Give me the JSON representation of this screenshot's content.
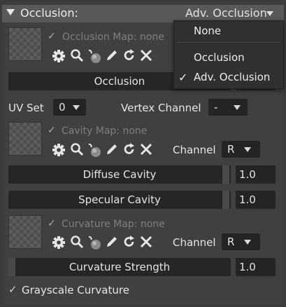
{
  "header": {
    "title": "Occlusion:",
    "mode_label": "Adv. Occlusion"
  },
  "mode_menu": {
    "items": [
      {
        "label": "None",
        "checked": false
      },
      {
        "label": "Occlusion",
        "checked": false
      },
      {
        "label": "Adv. Occlusion",
        "checked": true
      }
    ]
  },
  "occlusion_map": {
    "label": "Occlusion Map:",
    "value": "none",
    "enabled": true
  },
  "occlusion_slider": {
    "label": "Occlusion"
  },
  "uv_set": {
    "label": "UV Set",
    "value": "0"
  },
  "vertex_channel": {
    "label": "Vertex Channel",
    "value": "-"
  },
  "cavity_map": {
    "label": "Cavity Map:",
    "value": "none",
    "enabled": true,
    "channel_label": "Channel",
    "channel_value": "R"
  },
  "diffuse_cavity": {
    "label": "Diffuse Cavity",
    "value": "1.0",
    "level": 1.0
  },
  "specular_cavity": {
    "label": "Specular Cavity",
    "value": "1.0",
    "level": 1.0
  },
  "curvature_map": {
    "label": "Curvature Map:",
    "value": "none",
    "enabled": true,
    "channel_label": "Channel",
    "channel_value": "R"
  },
  "curvature_strength": {
    "label": "Curvature Strength",
    "value": "1.0",
    "level": 0.0
  },
  "grayscale_curvature": {
    "label": "Grayscale Curvature",
    "checked": true
  },
  "colors": {
    "panel": "#404040",
    "header": "#595959",
    "field": "#262626",
    "text": "#e6e6e6",
    "muted": "#7f7f7f"
  }
}
